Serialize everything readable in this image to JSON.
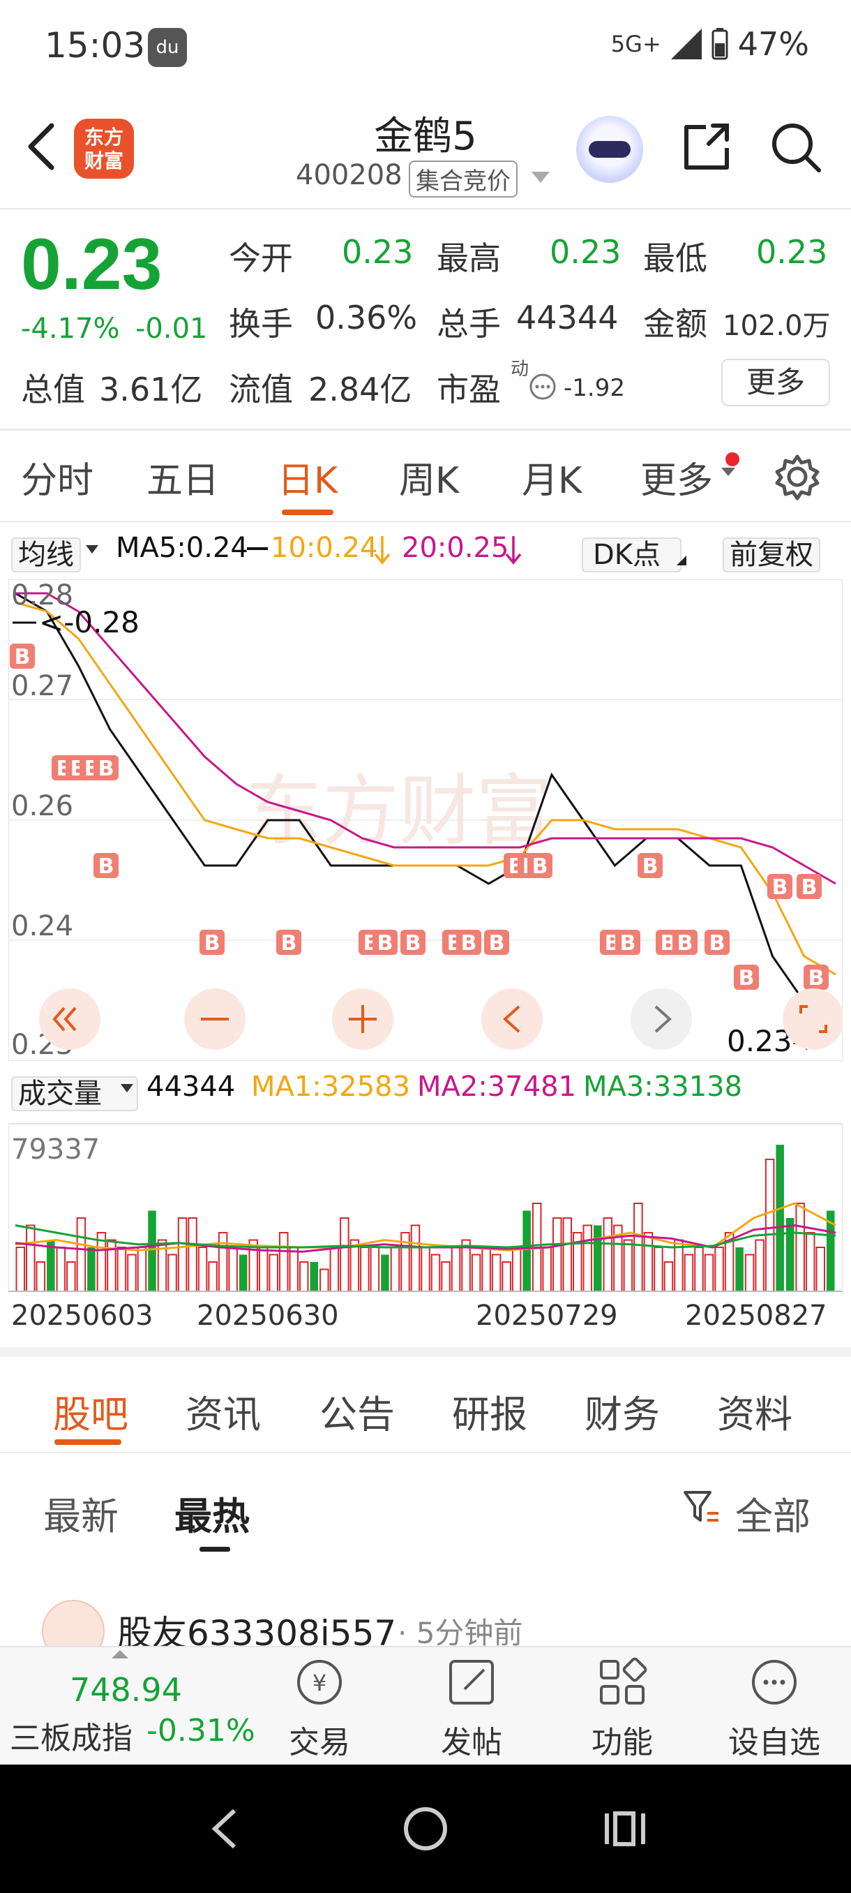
{
  "status_bar": {
    "time": "15:03",
    "network": "5G+",
    "battery": "47%"
  },
  "header": {
    "logo_text_1": "东方",
    "logo_text_2": "财富",
    "title": "金鹤5",
    "code": "400208",
    "tag": "集合竞价"
  },
  "quote": {
    "price": "0.23",
    "pct": "-4.17%",
    "change": "-0.01",
    "open_label": "今开",
    "open": "0.23",
    "high_label": "最高",
    "high": "0.23",
    "low_label": "最低",
    "low": "0.23",
    "turnover_label": "换手",
    "turnover": "0.36%",
    "volume_label": "总手",
    "volume": "44344",
    "amount_label": "金额",
    "amount": "102.0万",
    "mktcap_label": "总值",
    "mktcap": "3.61亿",
    "float_label": "流值",
    "float": "2.84亿",
    "pe_label": "市盈",
    "pe_sup": "动",
    "pe": "-1.92",
    "more_label": "更多"
  },
  "period_tabs": [
    "分时",
    "五日",
    "日K",
    "周K",
    "月K",
    "更多"
  ],
  "ma_bar": {
    "selector": "均线",
    "ma5": "MA5:0.24",
    "ma10": "10:0.24",
    "ma20": "20:0.25",
    "dk": "DK点",
    "adjust": "前复权"
  },
  "kchart_labels": {
    "y_028": "0.28",
    "y_027": "0.27",
    "y_026": "0.26",
    "y_024": "0.24",
    "y_023": "0.23",
    "high_marker": "0.28",
    "last_marker": "0.23->",
    "signal": "B"
  },
  "vol_bar": {
    "selector": "成交量",
    "vol": "44344",
    "ma1": "MA1:32583",
    "ma2": "MA2:37481",
    "ma3": "MA3:33138",
    "max": "79337"
  },
  "dates": [
    "20250603",
    "20250630",
    "20250729",
    "20250827"
  ],
  "section_tabs": [
    "股吧",
    "资讯",
    "公告",
    "研报",
    "财务",
    "资料"
  ],
  "sub_tabs": {
    "latest": "最新",
    "hot": "最热",
    "filter": "全部"
  },
  "post": {
    "user": "股友633308i557",
    "time": "· 5分钟前"
  },
  "bottom_bar": {
    "index_value": "748.94",
    "index_name": "三板成指",
    "index_pct": "-0.31%",
    "trade": "交易",
    "post": "发帖",
    "func": "功能",
    "watch": "设自选"
  },
  "colors": {
    "up": "#d8262c",
    "down": "#15a336",
    "accent": "#e35a1a",
    "ma5": "#111111",
    "ma10": "#f3a712",
    "ma20": "#c8188a"
  },
  "chart_data": {
    "type": "candlestick",
    "title": "",
    "ylim": [
      0.23,
      0.28
    ],
    "ma_series": [
      {
        "name": "MA5",
        "values": [
          0.28,
          0.278,
          0.272,
          0.265,
          0.26,
          0.255,
          0.25,
          0.25,
          0.255,
          0.255,
          0.25,
          0.25,
          0.25,
          0.25,
          0.25,
          0.248,
          0.25,
          0.26,
          0.255,
          0.25,
          0.253,
          0.253,
          0.25,
          0.25,
          0.24,
          0.235,
          0.235
        ]
      },
      {
        "name": "MA10",
        "values": [
          0.279,
          0.278,
          0.275,
          0.27,
          0.265,
          0.26,
          0.255,
          0.254,
          0.253,
          0.253,
          0.252,
          0.251,
          0.25,
          0.25,
          0.25,
          0.25,
          0.251,
          0.255,
          0.255,
          0.254,
          0.254,
          0.254,
          0.253,
          0.252,
          0.247,
          0.24,
          0.238
        ]
      },
      {
        "name": "MA20",
        "values": [
          0.28,
          0.28,
          0.278,
          0.274,
          0.27,
          0.266,
          0.262,
          0.259,
          0.257,
          0.256,
          0.255,
          0.253,
          0.252,
          0.252,
          0.252,
          0.252,
          0.252,
          0.253,
          0.253,
          0.253,
          0.253,
          0.253,
          0.253,
          0.253,
          0.252,
          0.25,
          0.248
        ]
      }
    ],
    "volume_ylim": [
      0,
      79337
    ]
  }
}
